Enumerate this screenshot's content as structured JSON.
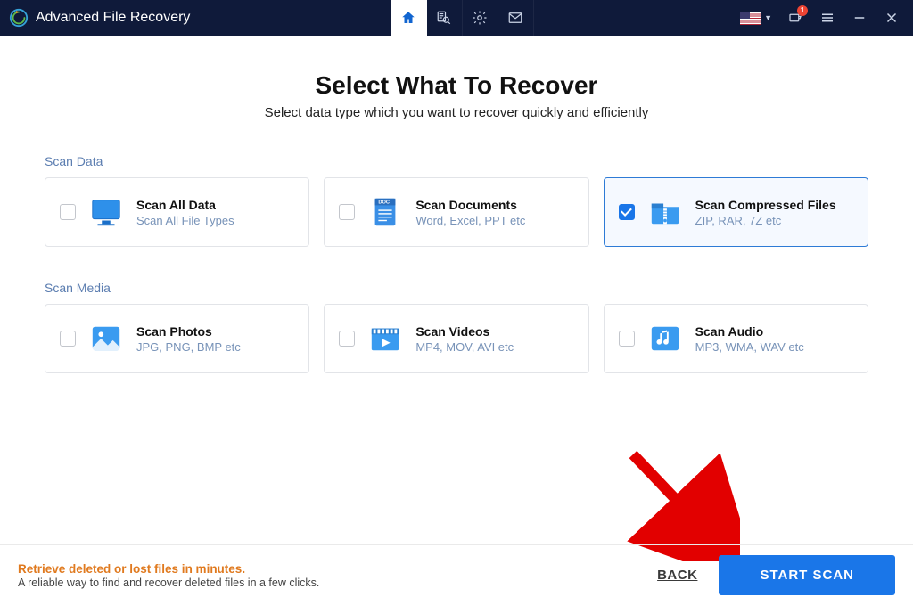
{
  "titlebar": {
    "app_name": "Advanced File Recovery",
    "notification_badge": "1"
  },
  "header": {
    "title": "Select What To Recover",
    "subtitle": "Select data type which you want to recover quickly and efficiently"
  },
  "sections": {
    "data": {
      "label": "Scan Data",
      "cards": [
        {
          "title": "Scan All Data",
          "desc": "Scan All File Types",
          "checked": false
        },
        {
          "title": "Scan Documents",
          "desc": "Word, Excel, PPT etc",
          "checked": false
        },
        {
          "title": "Scan Compressed Files",
          "desc": "ZIP, RAR, 7Z etc",
          "checked": true
        }
      ]
    },
    "media": {
      "label": "Scan Media",
      "cards": [
        {
          "title": "Scan Photos",
          "desc": "JPG, PNG, BMP etc",
          "checked": false
        },
        {
          "title": "Scan Videos",
          "desc": "MP4, MOV, AVI etc",
          "checked": false
        },
        {
          "title": "Scan Audio",
          "desc": "MP3, WMA, WAV etc",
          "checked": false
        }
      ]
    }
  },
  "footer": {
    "headline": "Retrieve deleted or lost files in minutes.",
    "sub": "A reliable way to find and recover deleted files in a few clicks.",
    "back": "BACK",
    "start": "START SCAN"
  }
}
